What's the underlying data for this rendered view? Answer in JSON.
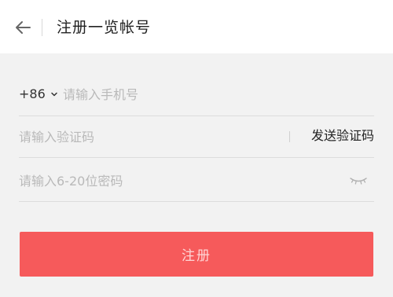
{
  "header": {
    "title": "注册一览帐号",
    "back_icon": "arrow-left-icon"
  },
  "form": {
    "country_code": "+86",
    "phone_placeholder": "请输入手机号",
    "code_placeholder": "请输入验证码",
    "send_code_label": "发送验证码",
    "password_placeholder": "请输入6-20位密码",
    "eye_icon": "eye-closed-icon"
  },
  "submit": {
    "label": "注册"
  },
  "colors": {
    "accent": "#f65a5b",
    "background": "#f2f2f2"
  }
}
